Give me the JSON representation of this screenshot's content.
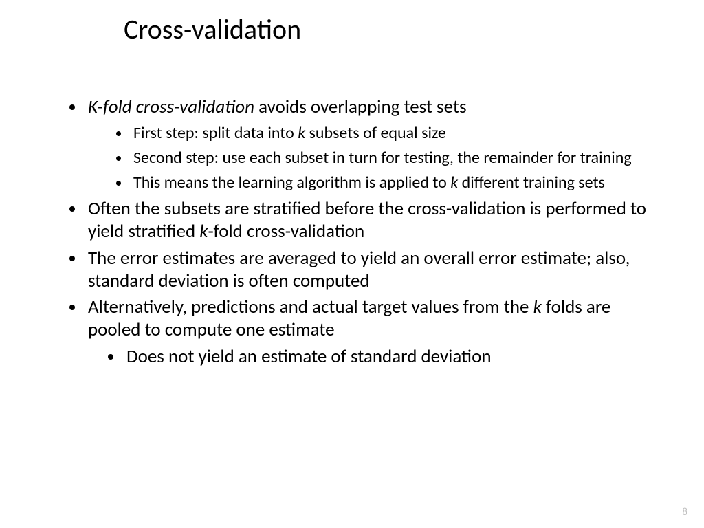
{
  "title": "Cross-validation",
  "page_number": "8",
  "b1_em": "K-fold cross-validation",
  "b1_rest": " avoids overlapping test sets",
  "b1_sub1_a": "First step: split data into ",
  "b1_sub1_k": "k",
  "b1_sub1_b": " subsets of equal size",
  "b1_sub2": "Second step: use each subset in turn for testing, the remainder for training",
  "b1_sub3_a": "This means the learning algorithm is applied to ",
  "b1_sub3_k": "k",
  "b1_sub3_b": " different training sets",
  "b2_a": "Often the subsets are stratified before the cross-validation is performed to yield stratified ",
  "b2_k": "k",
  "b2_b": "-fold cross-validation",
  "b3": "The error estimates are averaged to yield an overall error estimate; also, standard deviation is often computed",
  "b4_a": "Alternatively, predictions and actual target values from the ",
  "b4_k": "k",
  "b4_b": " folds are pooled to compute one estimate",
  "b4_sub1": "Does not yield an estimate of standard deviation"
}
